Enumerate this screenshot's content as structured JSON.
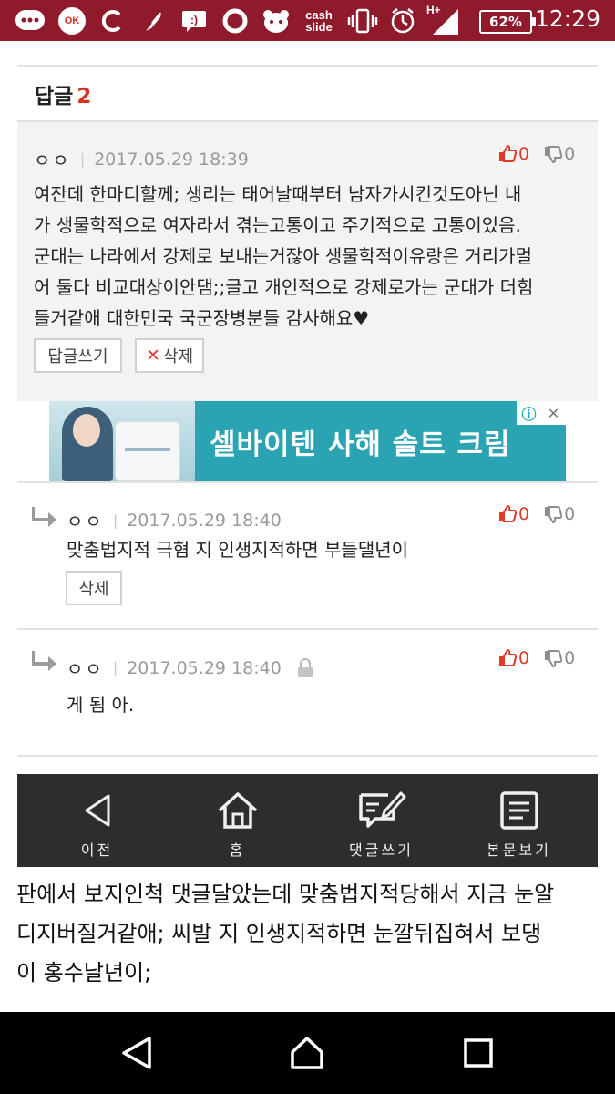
{
  "status_bar": {
    "time": "12:29",
    "battery": "62%",
    "network": "H+",
    "icons": [
      "chat-icon",
      "ok-cashbag-icon",
      "c-icon",
      "feather-icon",
      "message-icon",
      "circle-icon",
      "bear-icon",
      "cashslide-icon",
      "vibrate-icon",
      "alarm-icon",
      "signal-icon"
    ],
    "ok_label": "OK",
    "cash_label_1": "cash",
    "cash_label_2": "slide",
    "background_color": "#8e1a2c"
  },
  "replies": {
    "title": "답글",
    "count": "2"
  },
  "comment": {
    "author": "ㅇㅇ",
    "date": "2017.05.29 18:39",
    "upvotes": "0",
    "downvotes": "0",
    "lines": [
      "여잔데 한마디할께; 생리는 태어날때부터 남자가시킨것도아닌 내",
      "가 생물학적으로 여자라서 겪는고통이고 주기적으로 고통이있음.",
      "군대는 나라에서 강제로 보내는거잖아 생물학적이유랑은 거리가멀",
      "어 둘다 비교대상이안댐;;글고 개인적으로 강제로가는 군대가 더힘",
      "들거같애 대한민국 국군장병분들 감사해요♥"
    ],
    "reply_button": "답글쓰기",
    "delete_button": "삭제"
  },
  "ad": {
    "text": "셀바이텐 사해 솔트 크림",
    "info_icon": "ⓘ",
    "close_icon": "✕"
  },
  "sub_replies": [
    {
      "author": "ㅇㅇ",
      "date": "2017.05.29 18:40",
      "upvotes": "0",
      "downvotes": "0",
      "text": "맞춤법지적 극혐 지 인생지적하면 부들댈년이",
      "delete_button": "삭제",
      "locked": false
    },
    {
      "author": "ㅇㅇ",
      "date": "2017.05.29 18:40",
      "upvotes": "0",
      "downvotes": "0",
      "text": "게 됨 아.",
      "locked": true
    }
  ],
  "bottom_nav": {
    "items": [
      {
        "label": "이전",
        "icon": "back-triangle-icon"
      },
      {
        "label": "홈",
        "icon": "home-icon"
      },
      {
        "label": "댓글쓰기",
        "icon": "write-comment-icon"
      },
      {
        "label": "본문보기",
        "icon": "document-icon"
      }
    ]
  },
  "footer": {
    "lines": [
      "판에서 보지인척 댓글달았는데 맞춤법지적당해서 지금 눈알",
      "디지버질거같애; 씨발 지 인생지적하면 눈깔뒤집혀서 보댕",
      "이 홍수날년이;"
    ]
  },
  "colors": {
    "accent_red": "#d9321f",
    "nav_background": "#2d2d2d",
    "ad_background": "#2aa3b3"
  }
}
